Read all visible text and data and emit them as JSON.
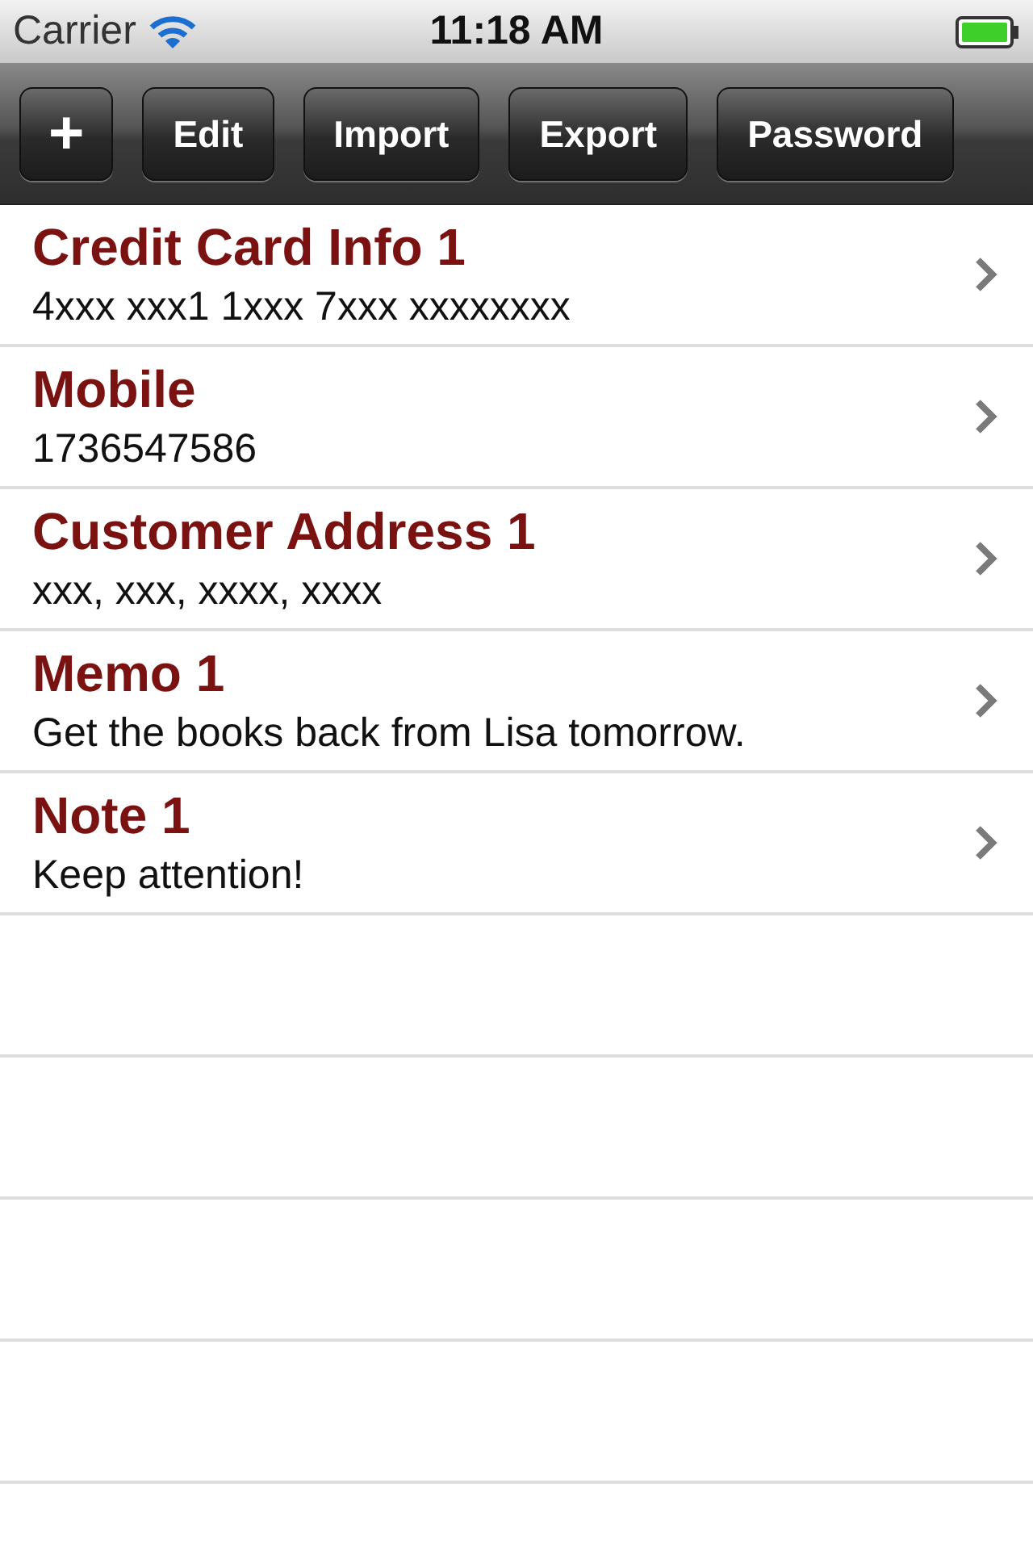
{
  "status_bar": {
    "carrier": "Carrier",
    "time": "11:18 AM"
  },
  "toolbar": {
    "buttons": [
      {
        "label": "+",
        "kind": "add"
      },
      {
        "label": "Edit",
        "kind": "text"
      },
      {
        "label": "Import",
        "kind": "text"
      },
      {
        "label": "Export",
        "kind": "text"
      },
      {
        "label": "Password",
        "kind": "text"
      }
    ]
  },
  "list": {
    "items": [
      {
        "title": "Credit Card Info 1",
        "subtitle": "4xxx xxx1 1xxx 7xxx xxxxxxxx"
      },
      {
        "title": "Mobile",
        "subtitle": "1736547586"
      },
      {
        "title": "Customer Address 1",
        "subtitle": "xxx, xxx, xxxx, xxxx"
      },
      {
        "title": "Memo 1",
        "subtitle": "Get the books back from Lisa tomorrow."
      },
      {
        "title": "Note 1",
        "subtitle": "Keep attention!"
      }
    ]
  }
}
